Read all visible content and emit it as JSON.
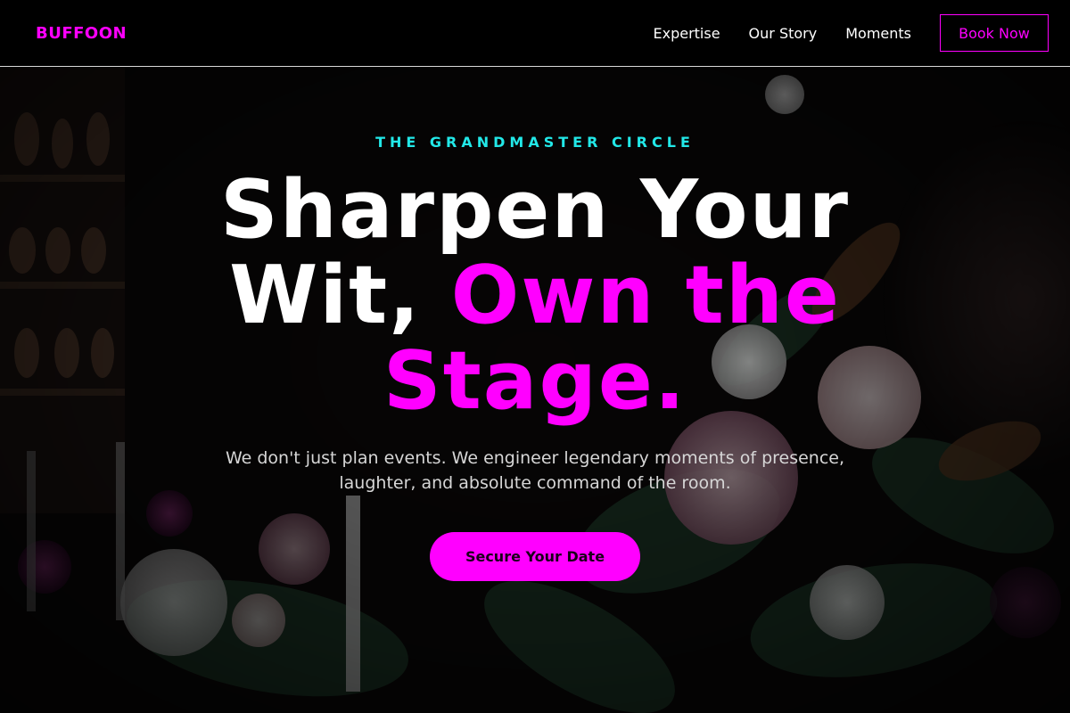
{
  "brand": {
    "name": "BUFFOON",
    "accent_color": "#ff00ff",
    "secondary_color": "#22e8e8"
  },
  "nav": {
    "links": [
      {
        "label": "Expertise"
      },
      {
        "label": "Our Story"
      },
      {
        "label": "Moments"
      }
    ],
    "cta_label": "Book Now"
  },
  "hero": {
    "eyebrow": "THE GRANDMASTER CIRCLE",
    "headline_part1": "Sharpen Your Wit, ",
    "headline_accent": "Own the Stage.",
    "subtext": "We don't just plan events. We engineer legendary moments of presence, laughter, and absolute command of the room.",
    "cta_label": "Secure Your Date",
    "background": "dark floral arrangement photo"
  }
}
